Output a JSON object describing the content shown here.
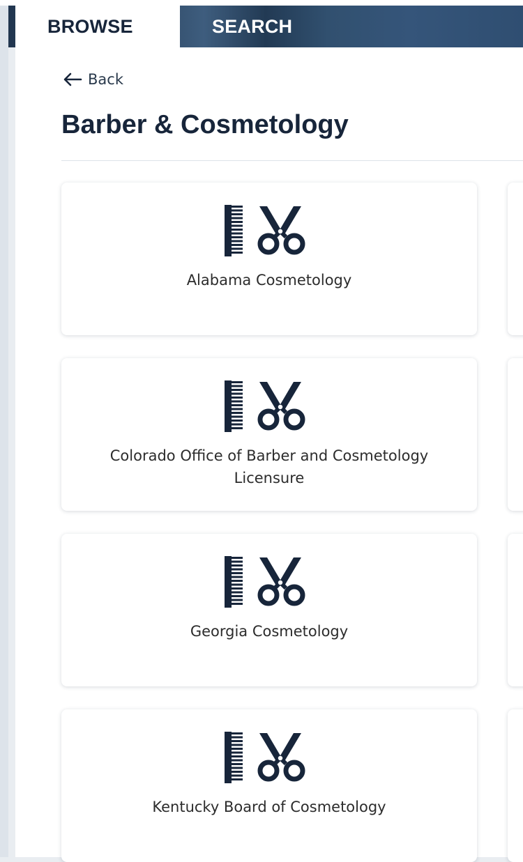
{
  "tabs": [
    {
      "label": "BROWSE",
      "active": true
    },
    {
      "label": "SEARCH",
      "active": false
    }
  ],
  "back": {
    "label": "Back",
    "icon": "arrow-left-icon"
  },
  "page": {
    "title": "Barber & Cosmetology"
  },
  "cards": [
    {
      "label": "Alabama Cosmetology",
      "icon": "comb-scissors-icon"
    },
    {
      "label": "Colorado Office of Barber and Cosmetology Licensure",
      "icon": "comb-scissors-icon"
    },
    {
      "label": "Georgia Cosmetology",
      "icon": "comb-scissors-icon"
    },
    {
      "label": "Kentucky Board of Cosmetology",
      "icon": "comb-scissors-icon"
    }
  ],
  "colors": {
    "navy": "#17253a",
    "tabbar": "#2d4763",
    "card_bg": "#ffffff",
    "page_bg": "#e9edf1"
  }
}
